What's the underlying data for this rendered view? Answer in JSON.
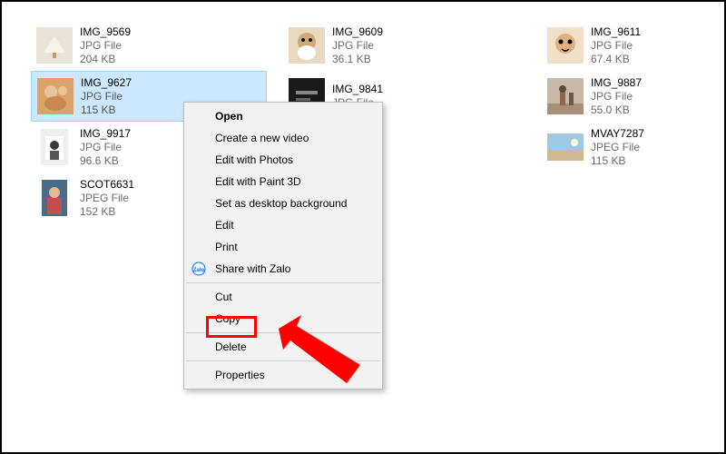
{
  "files": {
    "col1": [
      {
        "name": "IMG_9569",
        "type": "JPG File",
        "size": "204 KB",
        "thumb": "umbrella"
      },
      {
        "name": "IMG_9627",
        "type": "JPG File",
        "size": "115 KB",
        "thumb": "cat1",
        "selected": true
      },
      {
        "name": "IMG_9917",
        "type": "JPG File",
        "size": "96.6 KB",
        "thumb": "girl"
      },
      {
        "name": "SCOT6631",
        "type": "JPEG File",
        "size": "152 KB",
        "thumb": "portrait"
      }
    ],
    "col2": [
      {
        "name": "IMG_9609",
        "type": "JPG File",
        "size": "36.1 KB",
        "thumb": "cat2"
      },
      {
        "name": "IMG_9841",
        "type": "JPG File",
        "size": "",
        "thumb": "dark"
      }
    ],
    "col3": [
      {
        "name": "IMG_9611",
        "type": "JPG File",
        "size": "67.4 KB",
        "thumb": "cat3"
      },
      {
        "name": "IMG_9887",
        "type": "JPG File",
        "size": "55.0 KB",
        "thumb": "beach"
      },
      {
        "name": "MVAY7287",
        "type": "JPEG File",
        "size": "115 KB",
        "thumb": "landscape"
      }
    ]
  },
  "context_menu": {
    "open": "Open",
    "create_video": "Create a new video",
    "edit_photos": "Edit with Photos",
    "edit_paint3d": "Edit with Paint 3D",
    "set_bg": "Set as desktop background",
    "edit": "Edit",
    "print": "Print",
    "share_zalo": "Share with Zalo",
    "cut": "Cut",
    "copy": "Copy",
    "delete": "Delete",
    "properties": "Properties"
  },
  "annotations": {
    "highlight_target": "copy",
    "arrow_color": "#ff0000"
  }
}
